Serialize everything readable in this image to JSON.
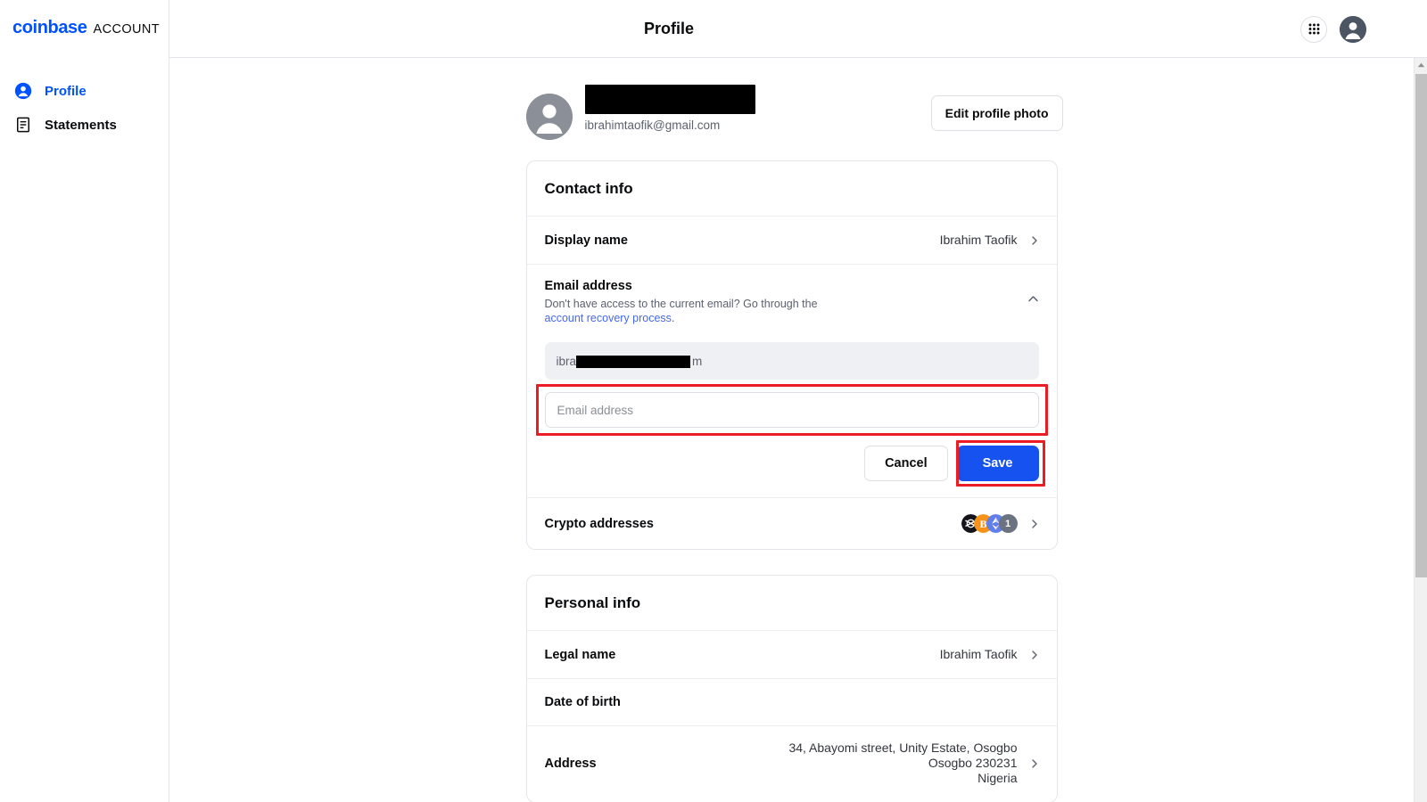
{
  "sidebar": {
    "brand": {
      "primary": "coinbase",
      "secondary": "ACCOUNT"
    },
    "items": [
      {
        "label": "Profile",
        "icon": "person-circle-icon",
        "active": true
      },
      {
        "label": "Statements",
        "icon": "document-list-icon",
        "active": false
      }
    ]
  },
  "topbar": {
    "title": "Profile",
    "apps_icon": "grid-apps-icon",
    "avatar_icon": "user-avatar-icon"
  },
  "profile_header": {
    "name_redacted": "",
    "email": "ibrahimtaofik@gmail.com",
    "edit_photo_label": "Edit profile photo"
  },
  "contact_info": {
    "title": "Contact info",
    "display_name": {
      "label": "Display name",
      "value": "Ibrahim Taofik"
    },
    "email_address": {
      "label": "Email address",
      "help_prefix": "Don't have access to the current email? Go through the ",
      "help_link": "account recovery process",
      "help_suffix": ".",
      "current_email": "ibra",
      "current_email_tail": "m",
      "new_email_value": "",
      "new_email_placeholder": "Email address",
      "cancel_label": "Cancel",
      "save_label": "Save",
      "collapse_icon": "chevron-up-icon"
    },
    "crypto_addresses": {
      "label": "Crypto addresses",
      "coins": [
        "XLM",
        "BTC",
        "ETH"
      ],
      "more_count": "1"
    }
  },
  "personal_info": {
    "title": "Personal info",
    "rows": [
      {
        "label": "Legal name",
        "value": "Ibrahim Taofik"
      },
      {
        "label": "Date of birth",
        "value": ""
      },
      {
        "label": "Address",
        "value": "34, Abayomi street, Unity Estate, Osogbo\nOsogbo 230231\nNigeria"
      }
    ]
  },
  "annotations": {
    "highlight_color": "#ec1c24",
    "targets": [
      "email-input",
      "save-button"
    ]
  }
}
